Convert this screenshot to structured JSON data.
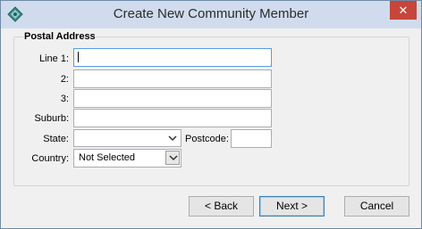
{
  "window": {
    "title": "Create New Community Member",
    "close_label": "✕"
  },
  "group": {
    "title": "Postal Address"
  },
  "form": {
    "line1_label": "Line 1:",
    "line1_value": "",
    "line2_label": "2:",
    "line2_value": "",
    "line3_label": "3:",
    "line3_value": "",
    "suburb_label": "Suburb:",
    "suburb_value": "",
    "state_label": "State:",
    "state_value": "",
    "postcode_label": "Postcode:",
    "postcode_value": "",
    "country_label": "Country:",
    "country_value": "Not Selected"
  },
  "buttons": {
    "back": "< Back",
    "next": "Next >",
    "cancel": "Cancel"
  },
  "colors": {
    "titlebar": "#d0dced",
    "close": "#c7453b",
    "focus_border": "#569de5",
    "window_bg": "#f0f0f0"
  }
}
